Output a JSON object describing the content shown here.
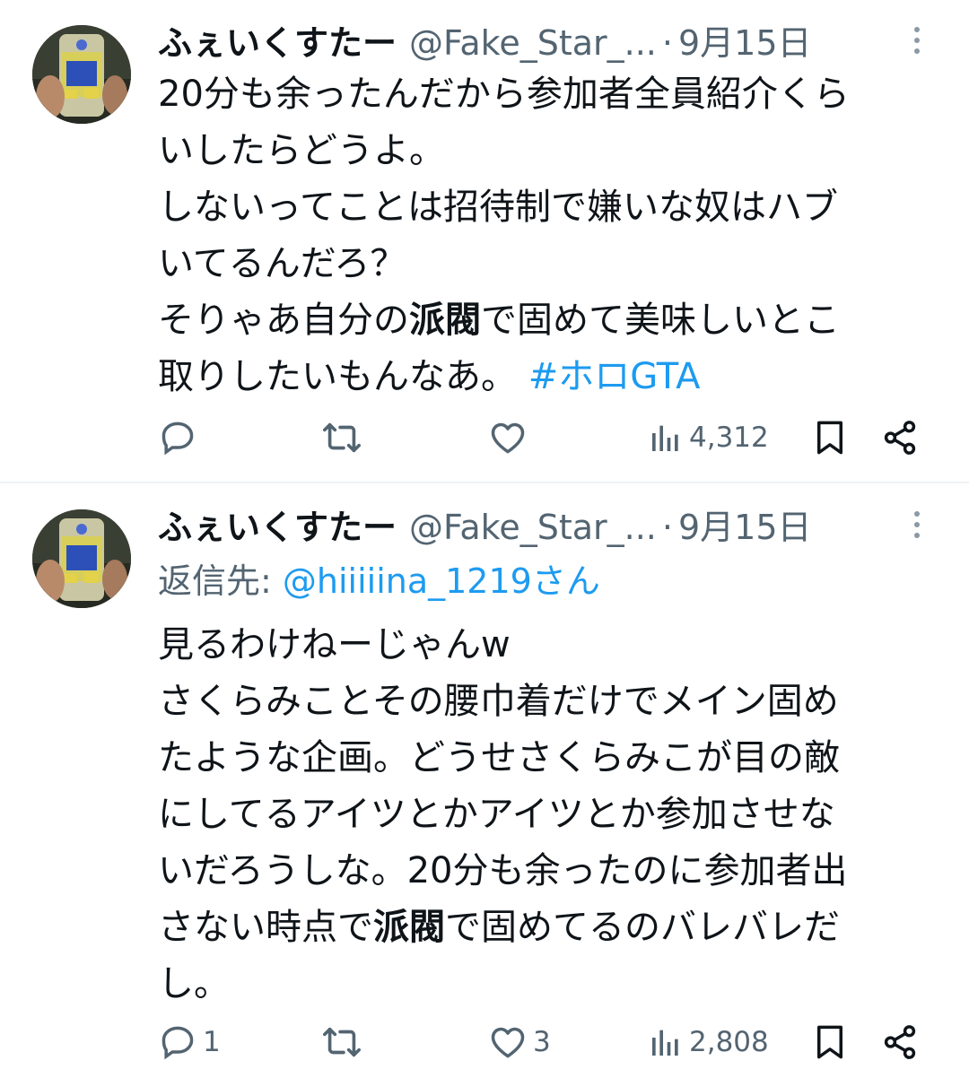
{
  "tweets": [
    {
      "author": {
        "name": "ふぇいくすたー",
        "handle": "@Fake_Star_...",
        "separator": "·",
        "date": "9月15日"
      },
      "body_lines": [
        "20分も余ったんだから参加者全員紹介くら",
        "いしたらどうよ。",
        "しないってことは招待制で嫌いな奴はハブ",
        "いてるんだろ？",
        "そりゃあ自分の派閥で固めて美味しいとこ",
        "取りしたいもんなあ。 #ホロGTA"
      ],
      "segments": {
        "l5_a": "そりゃあ自分の",
        "l5_b": "派閥",
        "l5_c": "で固めて美味しいとこ",
        "l6_a": "取りしたいもんなあ。 ",
        "l6_hashtag": "#ホロGTA"
      },
      "actions": {
        "reply_count": "",
        "retweet_count": "",
        "like_count": "",
        "views_count": "4,312"
      }
    },
    {
      "author": {
        "name": "ふぇいくすたー",
        "handle": "@Fake_Star_...",
        "separator": "·",
        "date": "9月15日"
      },
      "reply_to": {
        "label": "返信先: ",
        "mention": "@hiiiiina_1219さん"
      },
      "body_lines": [
        "見るわけねーじゃんw",
        "さくらみことその腰巾着だけでメイン固め",
        "たような企画。どうせさくらみこが目の敵",
        "にしてるアイツとかアイツとか参加させな",
        "いだろうしな。20分も余ったのに参加者出",
        "さない時点で派閥で固めてるのバレバレだ",
        "し。"
      ],
      "segments": {
        "l6_a": "さない時点で",
        "l6_b": "派閥",
        "l6_c": "で固めてるのバレバレだ"
      },
      "actions": {
        "reply_count": "1",
        "retweet_count": "",
        "like_count": "3",
        "views_count": "2,808"
      }
    }
  ],
  "icons": {
    "reply": "reply-icon",
    "retweet": "retweet-icon",
    "like": "heart-icon",
    "views": "views-icon",
    "bookmark": "bookmark-icon",
    "share": "share-icon",
    "more": "more-icon"
  },
  "colors": {
    "text": "#0f1419",
    "secondary": "#536471",
    "link": "#1d9bf0",
    "divider": "#eff3f4"
  }
}
